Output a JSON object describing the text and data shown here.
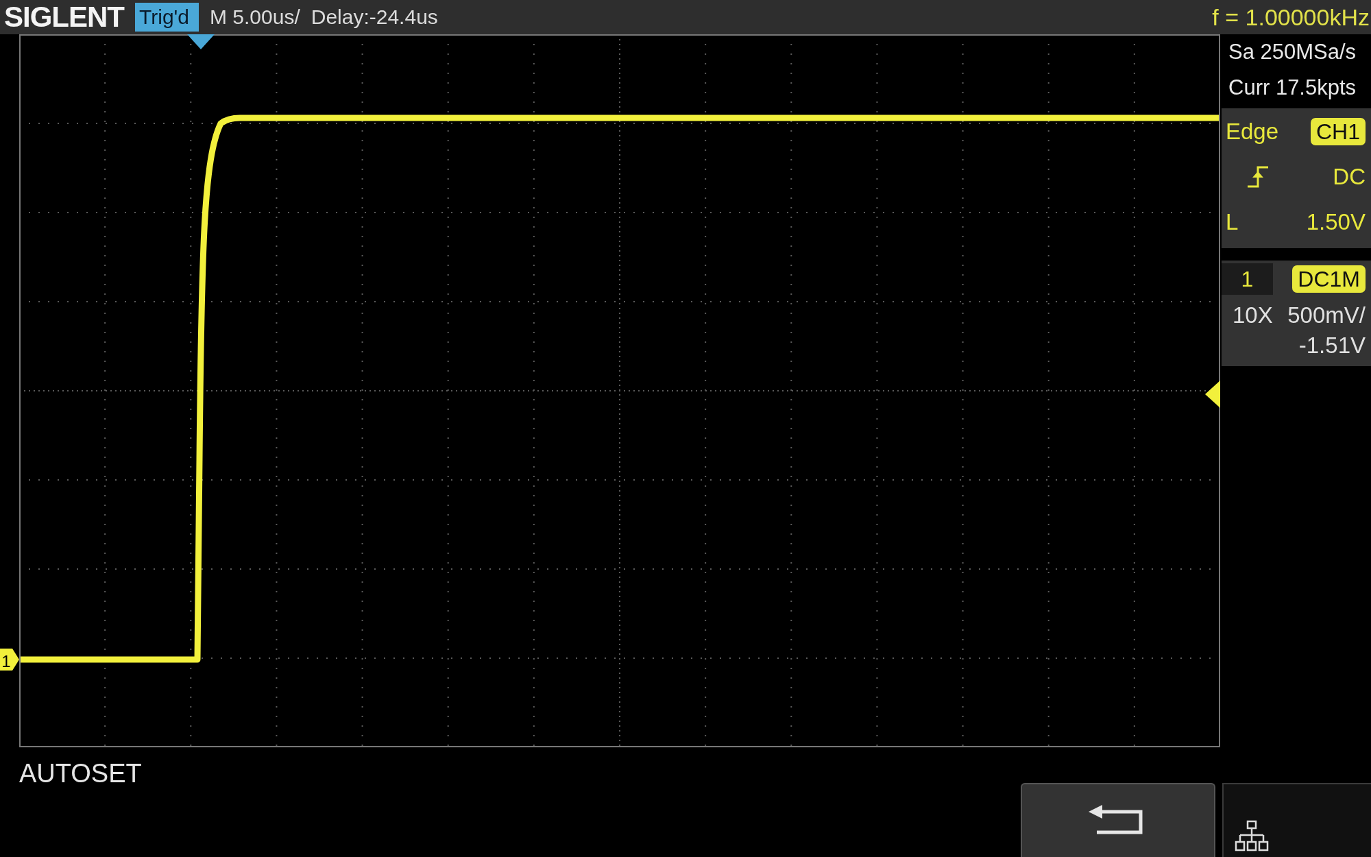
{
  "header": {
    "brand": "SIGLENT",
    "trigger_status": "Trig'd",
    "timebase": "M 5.00us/",
    "delay": "Delay:-24.4us",
    "frequency": "f = 1.00000kHz"
  },
  "acquisition": {
    "sample_rate": "Sa 250MSa/s",
    "memory": "Curr 17.5kpts"
  },
  "trigger": {
    "type": "Edge",
    "source": "CH1",
    "rising_edge": true,
    "coupling": "DC",
    "level_label": "L",
    "level_value": "1.50V"
  },
  "channel": {
    "number": "1",
    "coupling": "DC1M",
    "probe": "10X",
    "scale": "500mV/",
    "offset": "-1.51V"
  },
  "waveform_marker": {
    "label": "1"
  },
  "message": "AUTOSET",
  "softkeys": [
    {
      "kind": "back"
    },
    {
      "kind": "network"
    }
  ]
}
